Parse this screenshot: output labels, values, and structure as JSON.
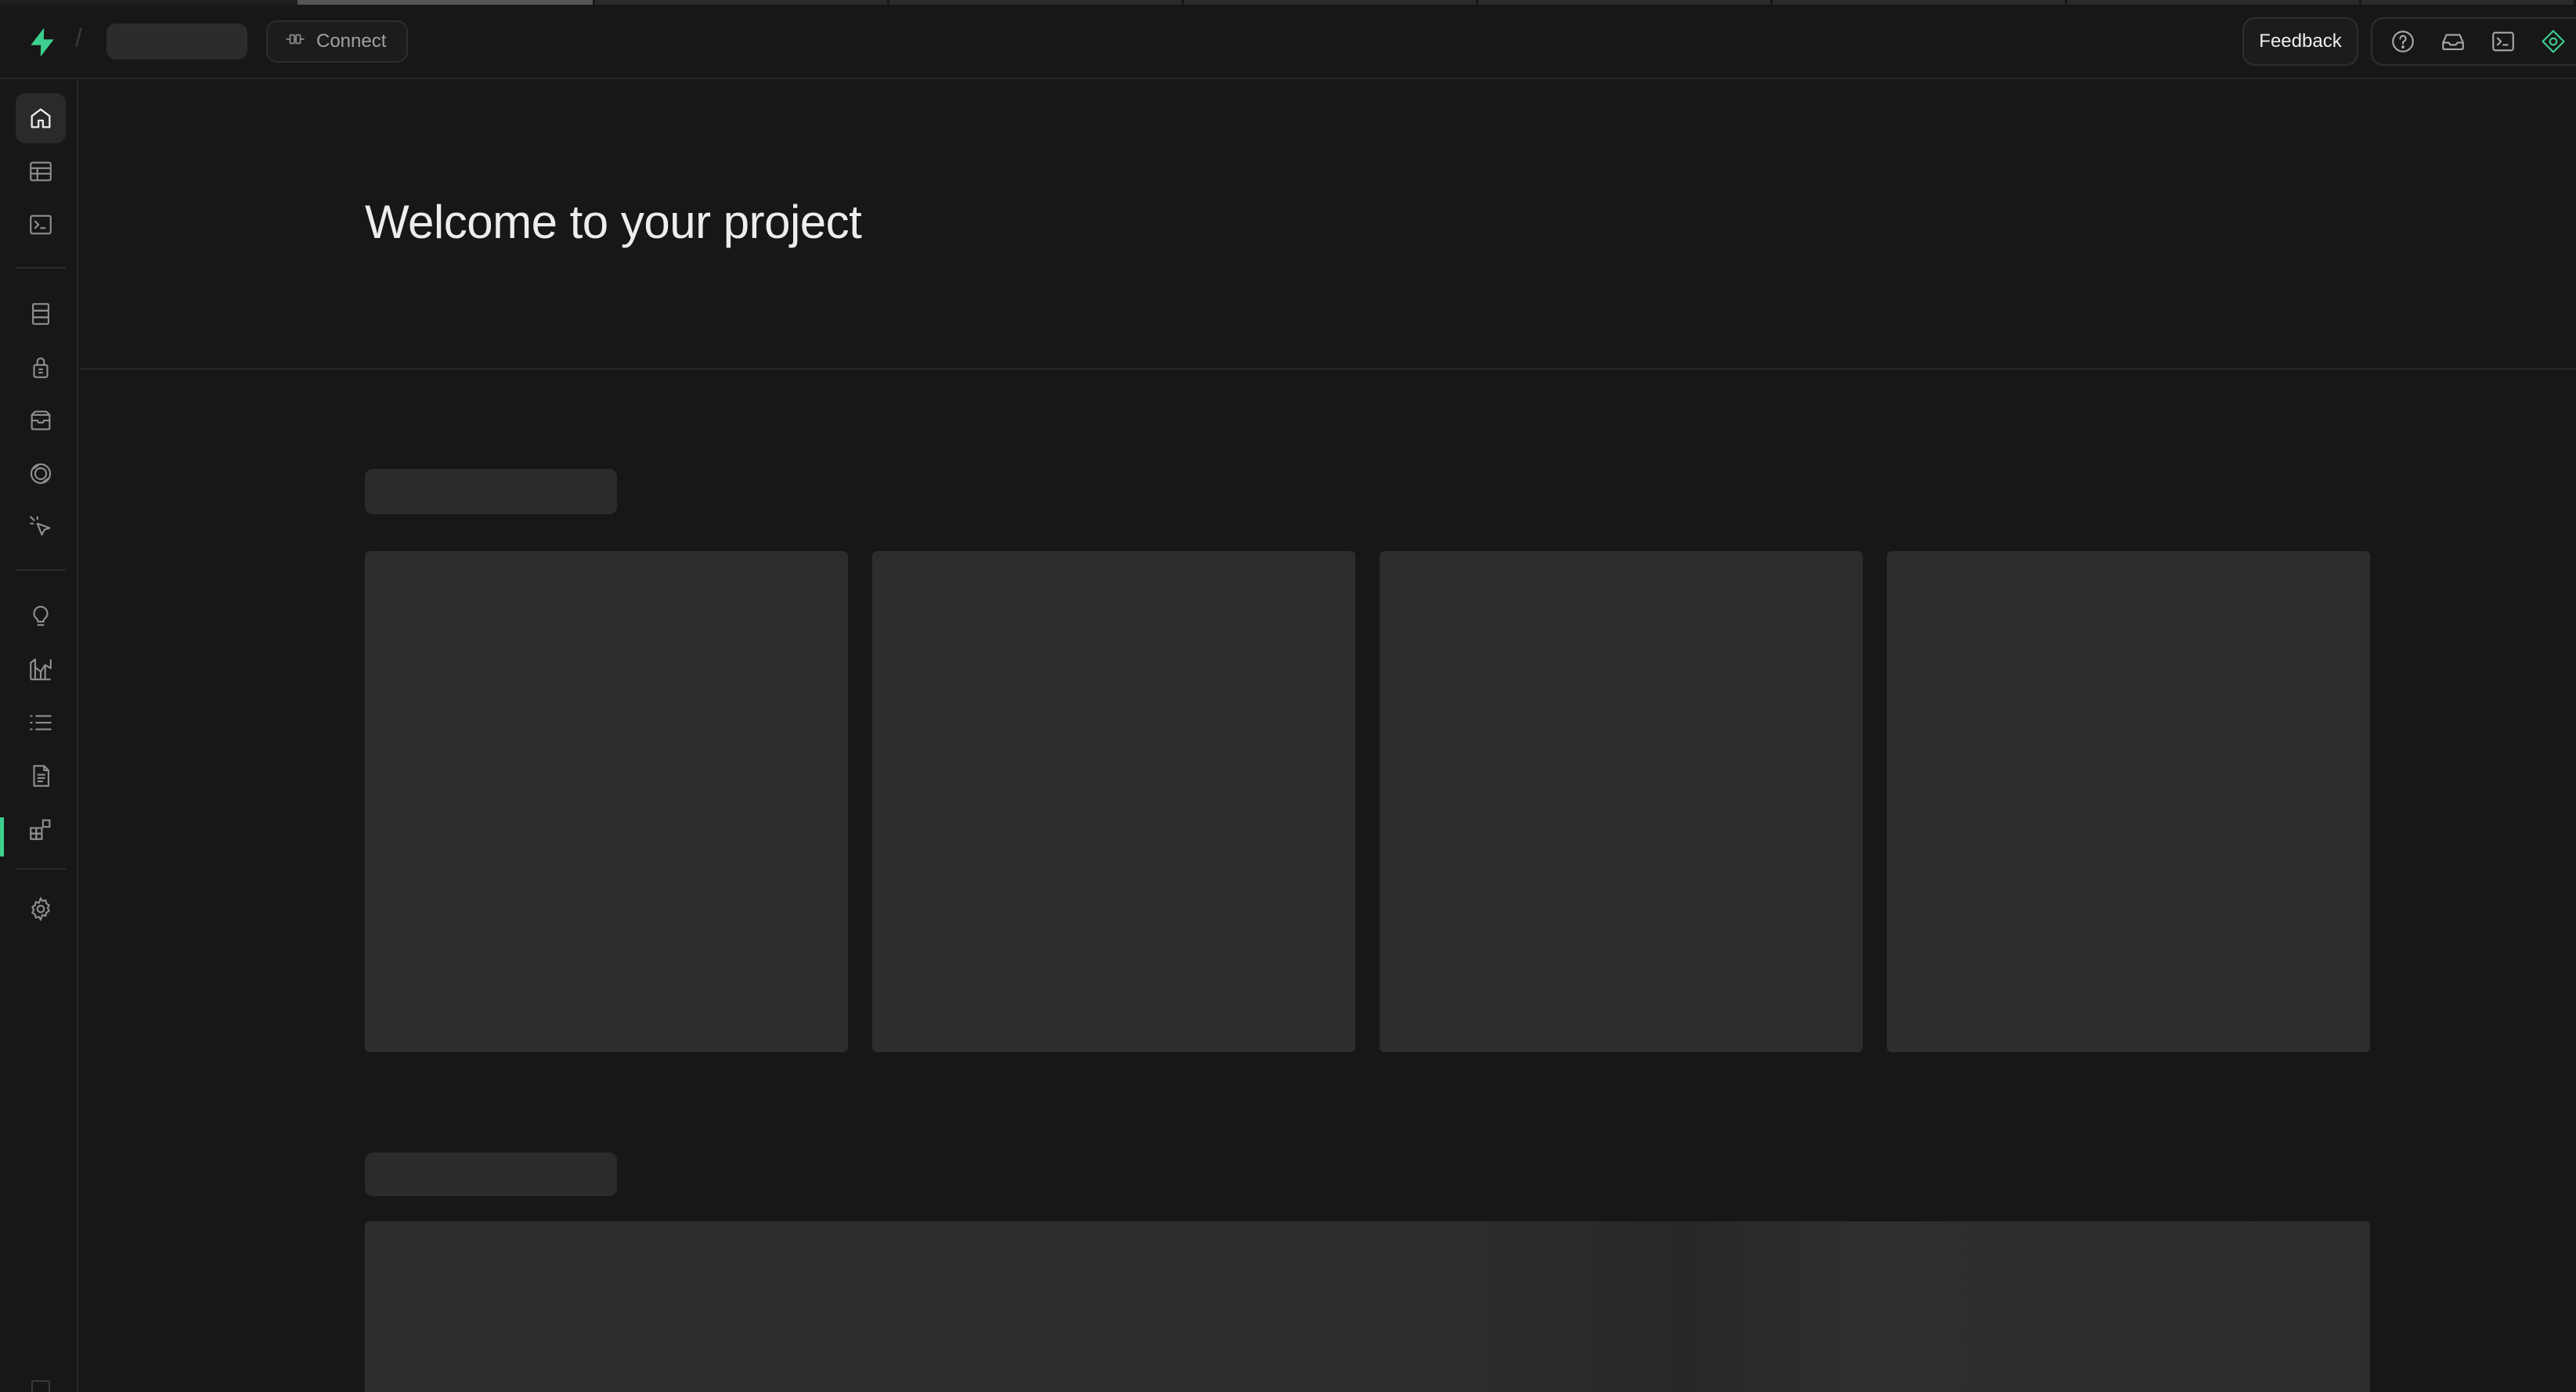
{
  "topbar": {
    "connect_label": "Connect",
    "feedback_label": "Feedback",
    "breadcrumb_separator": "/"
  },
  "main": {
    "title": "Welcome to your project"
  },
  "colors": {
    "background": "#171717",
    "brand": "#3ecf8e",
    "border": "#262626",
    "skeleton": "#2d2d2d"
  },
  "icons": {
    "top": [
      "help-icon",
      "inbox-icon",
      "terminal-icon",
      "assistant-icon"
    ],
    "sidebar": [
      "home-icon",
      "table-editor-icon",
      "sql-editor-icon",
      "database-icon",
      "auth-icon",
      "storage-icon",
      "realtime-icon",
      "edge-functions-icon",
      "advisors-icon",
      "reports-icon",
      "logs-icon",
      "api-docs-icon",
      "integrations-icon",
      "settings-icon"
    ]
  }
}
